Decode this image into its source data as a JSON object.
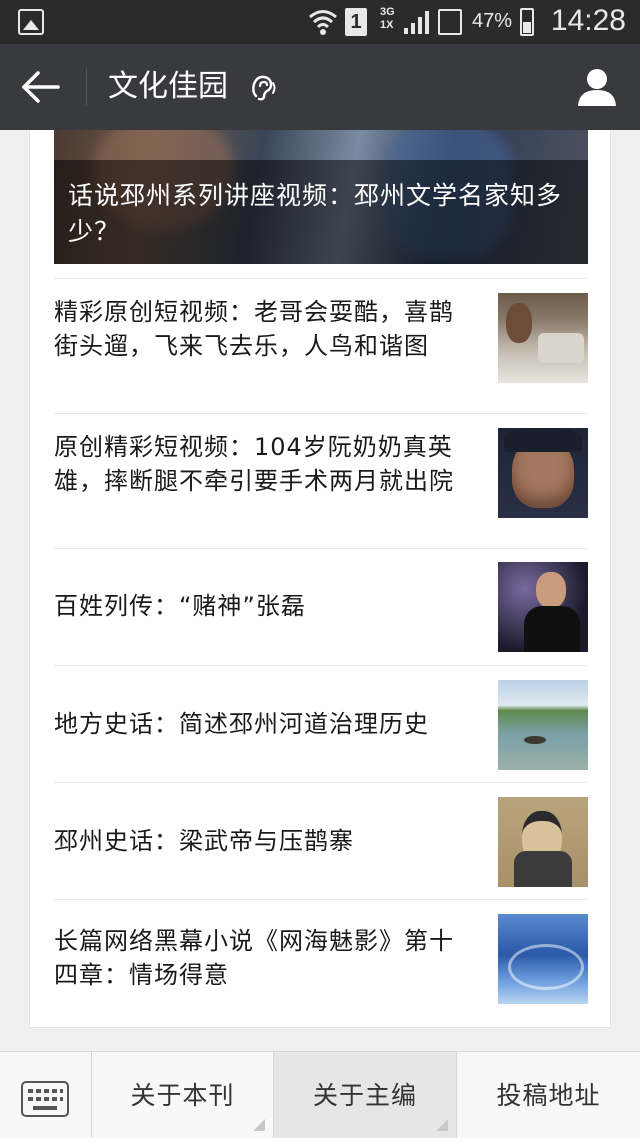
{
  "status_bar": {
    "sim_slot": "1",
    "network_top": "3G",
    "network_bottom": "1X",
    "battery": "47%",
    "time": "14:28"
  },
  "header": {
    "title": "文化佳园",
    "icons": [
      "back-arrow-icon",
      "ear-icon",
      "profile-icon"
    ]
  },
  "cover_article": {
    "title": "话说邳州系列讲座视频：邳州文学名家知多少？"
  },
  "articles": [
    {
      "title": "精彩原创短视频：老哥会耍酷，喜鹊街头遛，飞来飞去乐，人鸟和谐图"
    },
    {
      "title": "原创精彩短视频：104岁阮奶奶真英雄，摔断腿不牵引要手术两月就出院"
    },
    {
      "title": "百姓列传：“赌神”张磊"
    },
    {
      "title": "地方史话：简述邳州河道治理历史"
    },
    {
      "title": "邳州史话：梁武帝与压鹊寨"
    },
    {
      "title": "长篇网络黑幕小说《网海魅影》第十四章：情场得意"
    }
  ],
  "bottom_menu": {
    "keyboard_icon": "keyboard-icon",
    "items": [
      {
        "label": "关于本刊"
      },
      {
        "label": "关于主编"
      },
      {
        "label": "投稿地址"
      }
    ]
  },
  "colors": {
    "status_bar": "#2b2b2b",
    "header": "#393a3e",
    "background": "#f0f0f0"
  }
}
